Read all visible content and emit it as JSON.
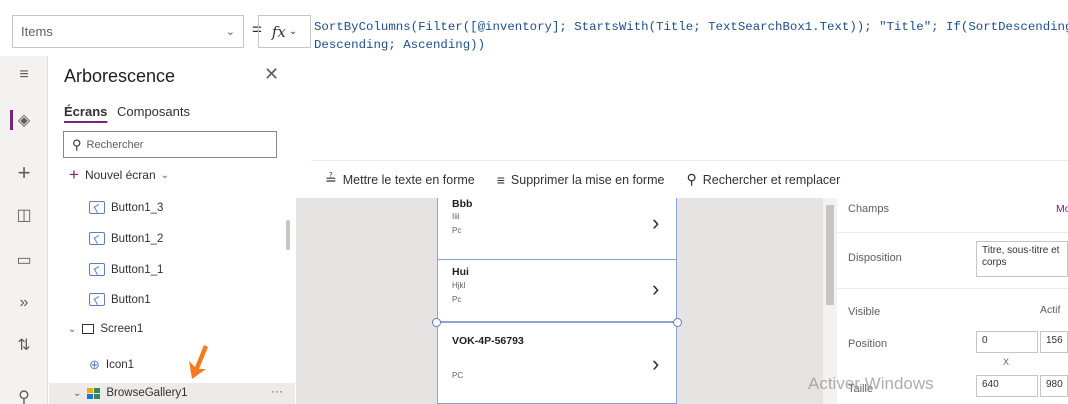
{
  "formula_bar": {
    "property": "Items",
    "equals": "=",
    "fx": "fx",
    "formula_line1": "SortByColumns(Filter([@inventory]; StartsWith(Title; TextSearchBox1.Text)); \"Title\"; If(SortDescending1;",
    "formula_line2": "Descending; Ascending))"
  },
  "tree_view": {
    "title": "Arborescence",
    "tabs": [
      "Écrans",
      "Composants"
    ],
    "search_placeholder": "Rechercher",
    "new_screen": "Nouvel écran",
    "items": [
      {
        "label": "Button1_3",
        "type": "button"
      },
      {
        "label": "Button1_2",
        "type": "button"
      },
      {
        "label": "Button1_1",
        "type": "button"
      },
      {
        "label": "Button1",
        "type": "button"
      },
      {
        "label": "Screen1",
        "type": "screen"
      },
      {
        "label": "Icon1",
        "type": "icon"
      },
      {
        "label": "BrowseGallery1",
        "type": "gallery"
      }
    ],
    "more": "···"
  },
  "format_toolbar": {
    "format_text": "Mettre le texte en forme",
    "remove_format": "Supprimer la mise en forme",
    "find_replace": "Rechercher et remplacer"
  },
  "gallery": [
    {
      "title": "Bbb",
      "subtitle": "Iiii",
      "body": "Pc"
    },
    {
      "title": "Hui",
      "subtitle": "Hjkl",
      "body": "Pc"
    },
    {
      "title": "VOK-4P-56793",
      "subtitle": "",
      "body": "PC"
    }
  ],
  "properties": {
    "fields_label": "Champs",
    "fields_value": "Mo",
    "layout_label": "Disposition",
    "layout_value": "Titre, sous-titre et corps",
    "visible_label": "Visible",
    "visible_value": "Actif",
    "position_label": "Position",
    "position_x": "0",
    "position_y": "156",
    "x_caption": "X",
    "size_label": "Taille",
    "size_w": "640",
    "size_h": "980"
  },
  "watermark": "Activer Windows",
  "colors": {
    "accent": "#742774",
    "selection": "#5b7fbf",
    "formula": "#1f4e8c"
  }
}
